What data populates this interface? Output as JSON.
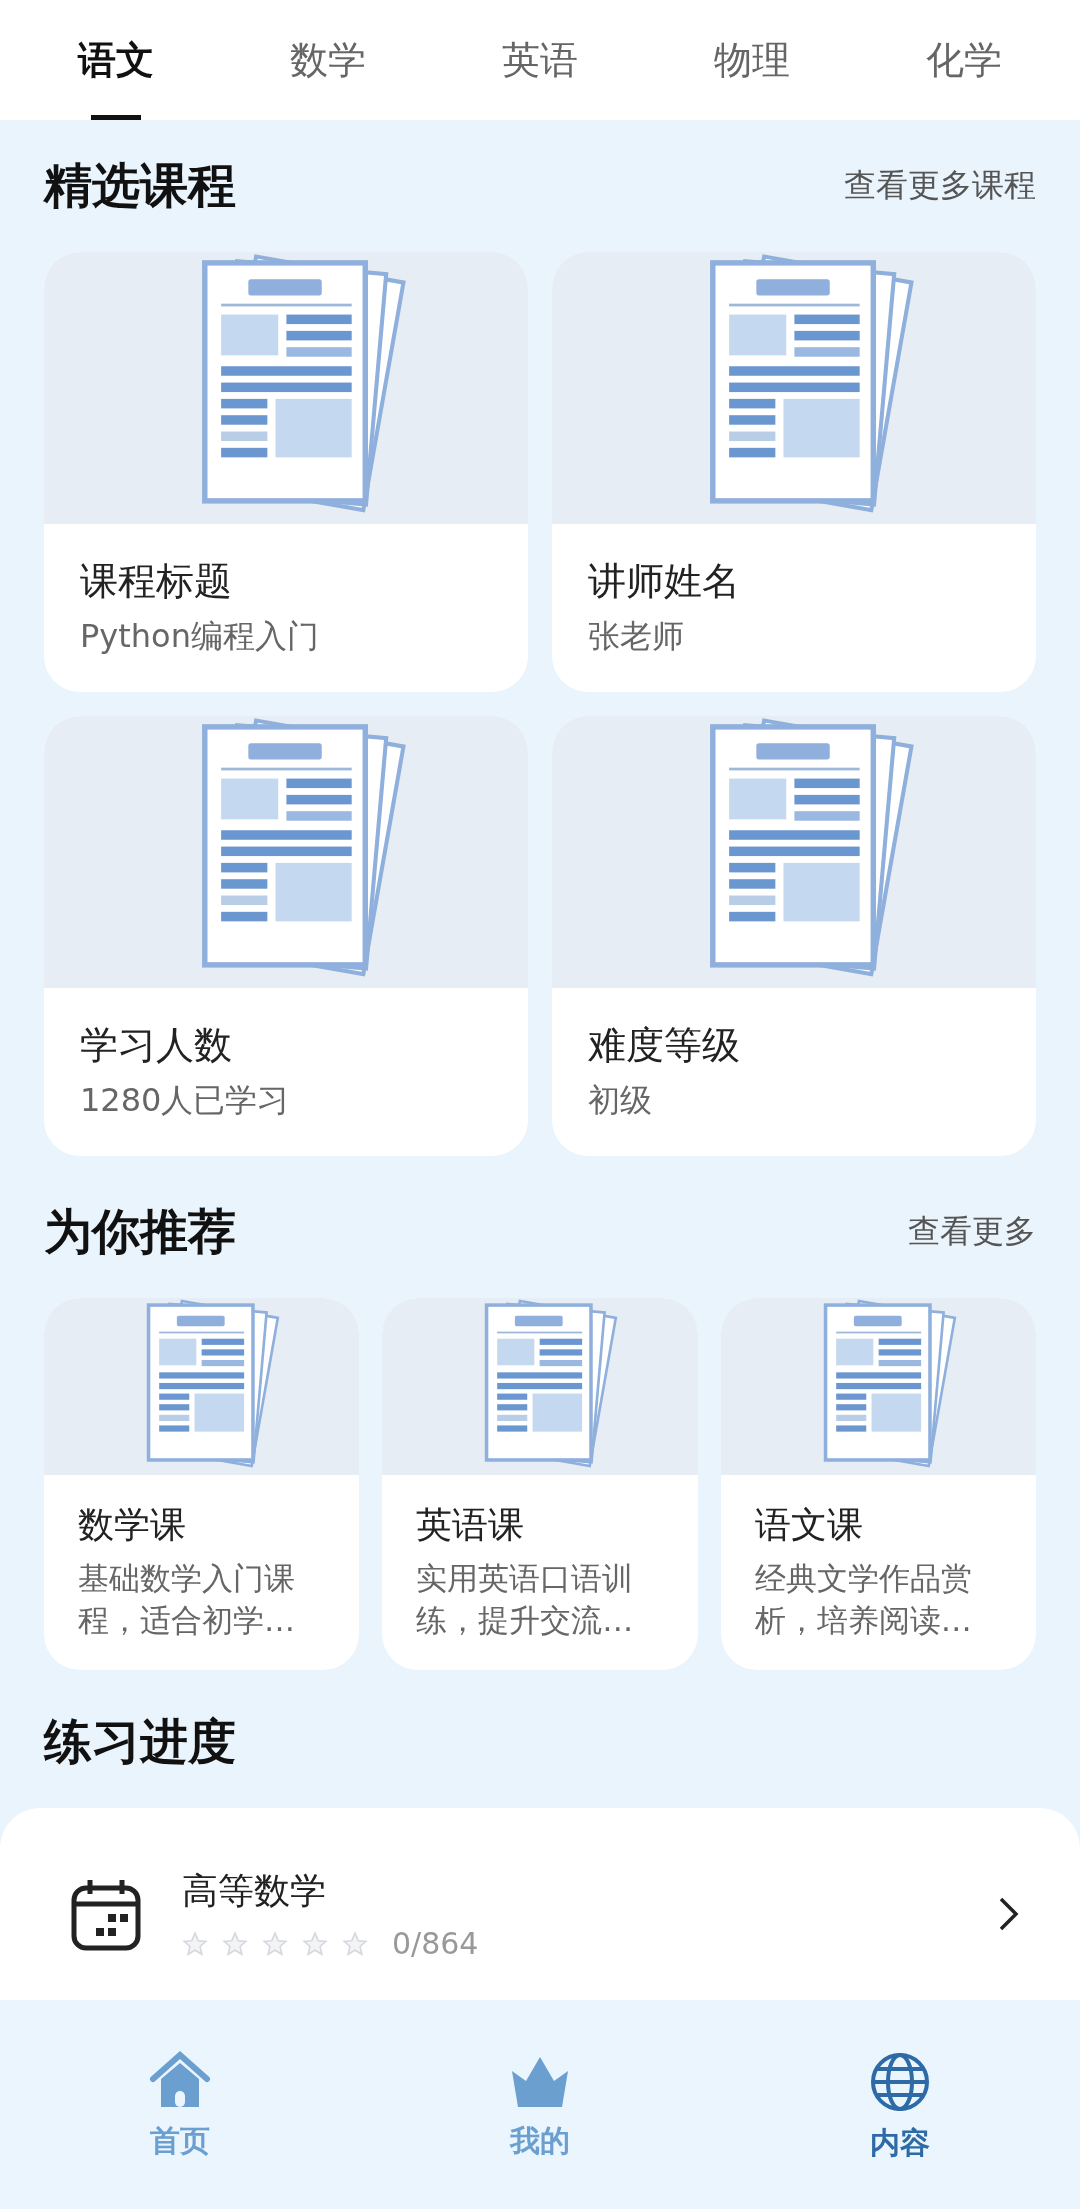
{
  "tabs": [
    {
      "label": "语文",
      "selected": true
    },
    {
      "label": "数学",
      "selected": false
    },
    {
      "label": "英语",
      "selected": false
    },
    {
      "label": "物理",
      "selected": false
    },
    {
      "label": "化学",
      "selected": false
    }
  ],
  "featured": {
    "title": "精选课程",
    "more": "查看更多课程",
    "cards": [
      {
        "kind": "picture",
        "title": "课程标题",
        "subtitle": "Python编程入门"
      },
      {
        "kind": "picture",
        "title": "讲师姓名",
        "subtitle": "张老师"
      },
      {
        "kind": "picture",
        "title": "学习人数",
        "subtitle": "1280人已学习"
      },
      {
        "kind": "picture",
        "title": "难度等级",
        "subtitle": "初级"
      }
    ]
  },
  "recommended": {
    "title": "为你推荐",
    "more": "查看更多",
    "cards": [
      {
        "kind": "picture",
        "title": "数学课",
        "description": "基础数学入门课程，适合初学…"
      },
      {
        "kind": "picture",
        "title": "英语课",
        "description": "实用英语口语训练，提升交流…"
      },
      {
        "kind": "picture",
        "title": "语文课",
        "description": "经典文学作品赏析，培养阅读…"
      }
    ]
  },
  "practice": {
    "title": "练习进度",
    "items": [
      {
        "name": "高等数学",
        "stars": 0,
        "count": "0/864"
      }
    ]
  },
  "bottom_nav": [
    {
      "label": "首页",
      "kind": "home",
      "selected": false
    },
    {
      "label": "我的",
      "kind": "vip",
      "selected": false
    },
    {
      "label": "内容",
      "kind": "globe",
      "selected": true
    }
  ]
}
